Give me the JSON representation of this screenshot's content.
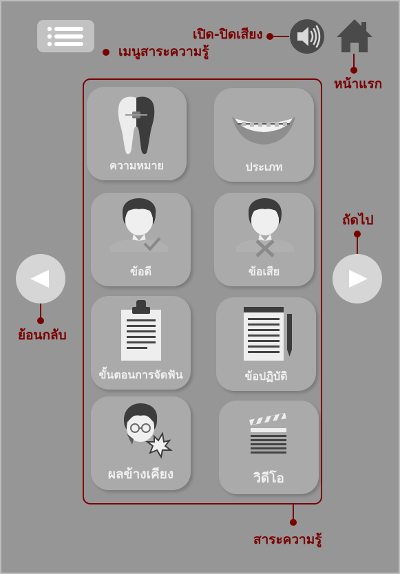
{
  "annotations": {
    "knowledge_menu": "เมนูสาระความรู้",
    "sound_toggle": "เปิด-ปิดเสียง",
    "home": "หน้าแรก",
    "next": "ถัดไป",
    "back": "ย้อนกลับ",
    "knowledge": "สาระความรู้"
  },
  "tiles": [
    {
      "label": "ความหมาย",
      "icon": "tooth-with-braces-icon"
    },
    {
      "label": "ประเภท",
      "icon": "braces-smile-icon"
    },
    {
      "label": "ข้อดี",
      "icon": "person-check-icon"
    },
    {
      "label": "ข้อเสีย",
      "icon": "person-cross-icon"
    },
    {
      "label": "ขั้นตอนการจัดฟัน",
      "icon": "clipboard-icon"
    },
    {
      "label": "ข้อปฏิบัติ",
      "icon": "notepad-pencil-icon"
    },
    {
      "label": "ผลข้างเคียง",
      "icon": "person-pain-icon"
    },
    {
      "label": "วิดีโอ",
      "icon": "clapperboard-icon"
    }
  ],
  "colors": {
    "background": "#969696",
    "annotation": "#7a0000",
    "tile": "#aaaaaa",
    "tile_text": "#efefef",
    "button_light": "#d6d6d6",
    "icon_dark": "#4a4a4a"
  }
}
